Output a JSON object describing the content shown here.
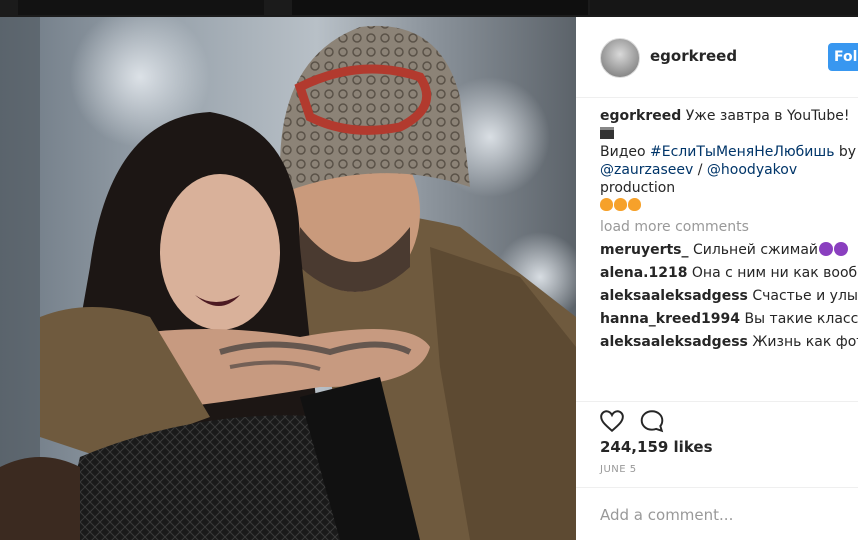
{
  "post": {
    "author": "egorkreed",
    "follow_label": "Follow",
    "caption": {
      "username": "egorkreed",
      "text_1": "Уже завтра в YouTube!",
      "text_2": "Видео ",
      "hashtag": "#ЕслиТыМеняНеЛюбишь",
      "text_3": " by",
      "mention_1": "@zaurzaseev",
      "separator": " / ",
      "mention_2": "@hoodyakov",
      "text_4": " production"
    },
    "load_more": "load more comments",
    "comments": [
      {
        "username": "meruyerts_",
        "text": "Сильней сжимай"
      },
      {
        "username": "alena.1218",
        "text": "Она с ним ни как вообще не смотрится через чур вульгарная"
      },
      {
        "username": "aleksaaleksadgess",
        "text": "Счастье и улыбка на лице тебе к лицу"
      },
      {
        "username": "hanna_kreed1994",
        "text": "Вы такие классные и суперские"
      },
      {
        "username": "aleksaaleksadgess",
        "text": "Жизнь как фотография.... получается лучше,"
      }
    ],
    "likes": "244,159 likes",
    "date": "JUNE 5",
    "add_comment_placeholder": "Add a comment...",
    "colors": {
      "accent": "#3897f0",
      "link": "#003569",
      "muted": "#999999"
    },
    "icons": [
      "heart-icon",
      "comment-icon",
      "fire-emoji",
      "devil-emoji",
      "clapper-emoji"
    ]
  }
}
